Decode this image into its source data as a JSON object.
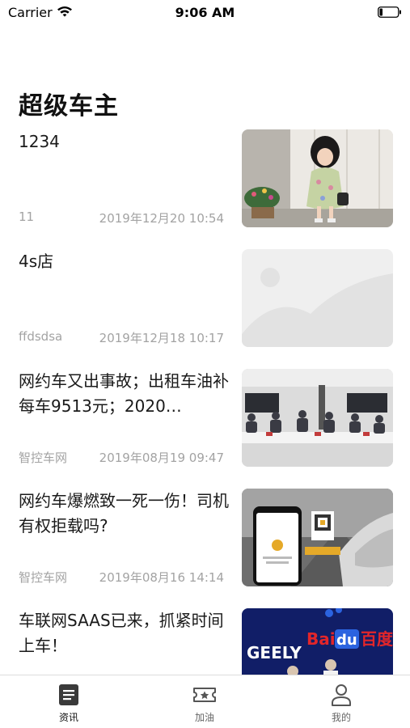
{
  "status_bar": {
    "carrier": "Carrier",
    "time": "9:06 AM"
  },
  "page": {
    "title": "超级车主"
  },
  "news": [
    {
      "title": "1234",
      "source": "11",
      "time": "2019年12月20 10:54",
      "thumbnail": "girl-photo"
    },
    {
      "title": "4s店",
      "source": "ffdsdsa",
      "time": "2019年12月18 10:17",
      "thumbnail": "placeholder-image"
    },
    {
      "title": "网约车又出事故；出租车油补每车9513元；2020…",
      "source": "智控车网",
      "time": "2019年08月19 09:47",
      "thumbnail": "meeting-photo"
    },
    {
      "title": "网约车爆燃致一死一伤！司机有权拒载吗?",
      "source": "智控车网",
      "time": "2019年08月16 14:14",
      "thumbnail": "car-phone-photo"
    },
    {
      "title": "车联网SAAS已来，抓紧时间上车！",
      "source": "",
      "time": "",
      "thumbnail": "baidu-geely-photo",
      "brand_texts": [
        "GEELY",
        "Bai",
        "du",
        "百度"
      ]
    }
  ],
  "tabs": [
    {
      "label": "资讯",
      "icon": "news-icon",
      "active": true
    },
    {
      "label": "加油",
      "icon": "ticket-star-icon",
      "active": false
    },
    {
      "label": "我的",
      "icon": "person-icon",
      "active": false
    }
  ]
}
